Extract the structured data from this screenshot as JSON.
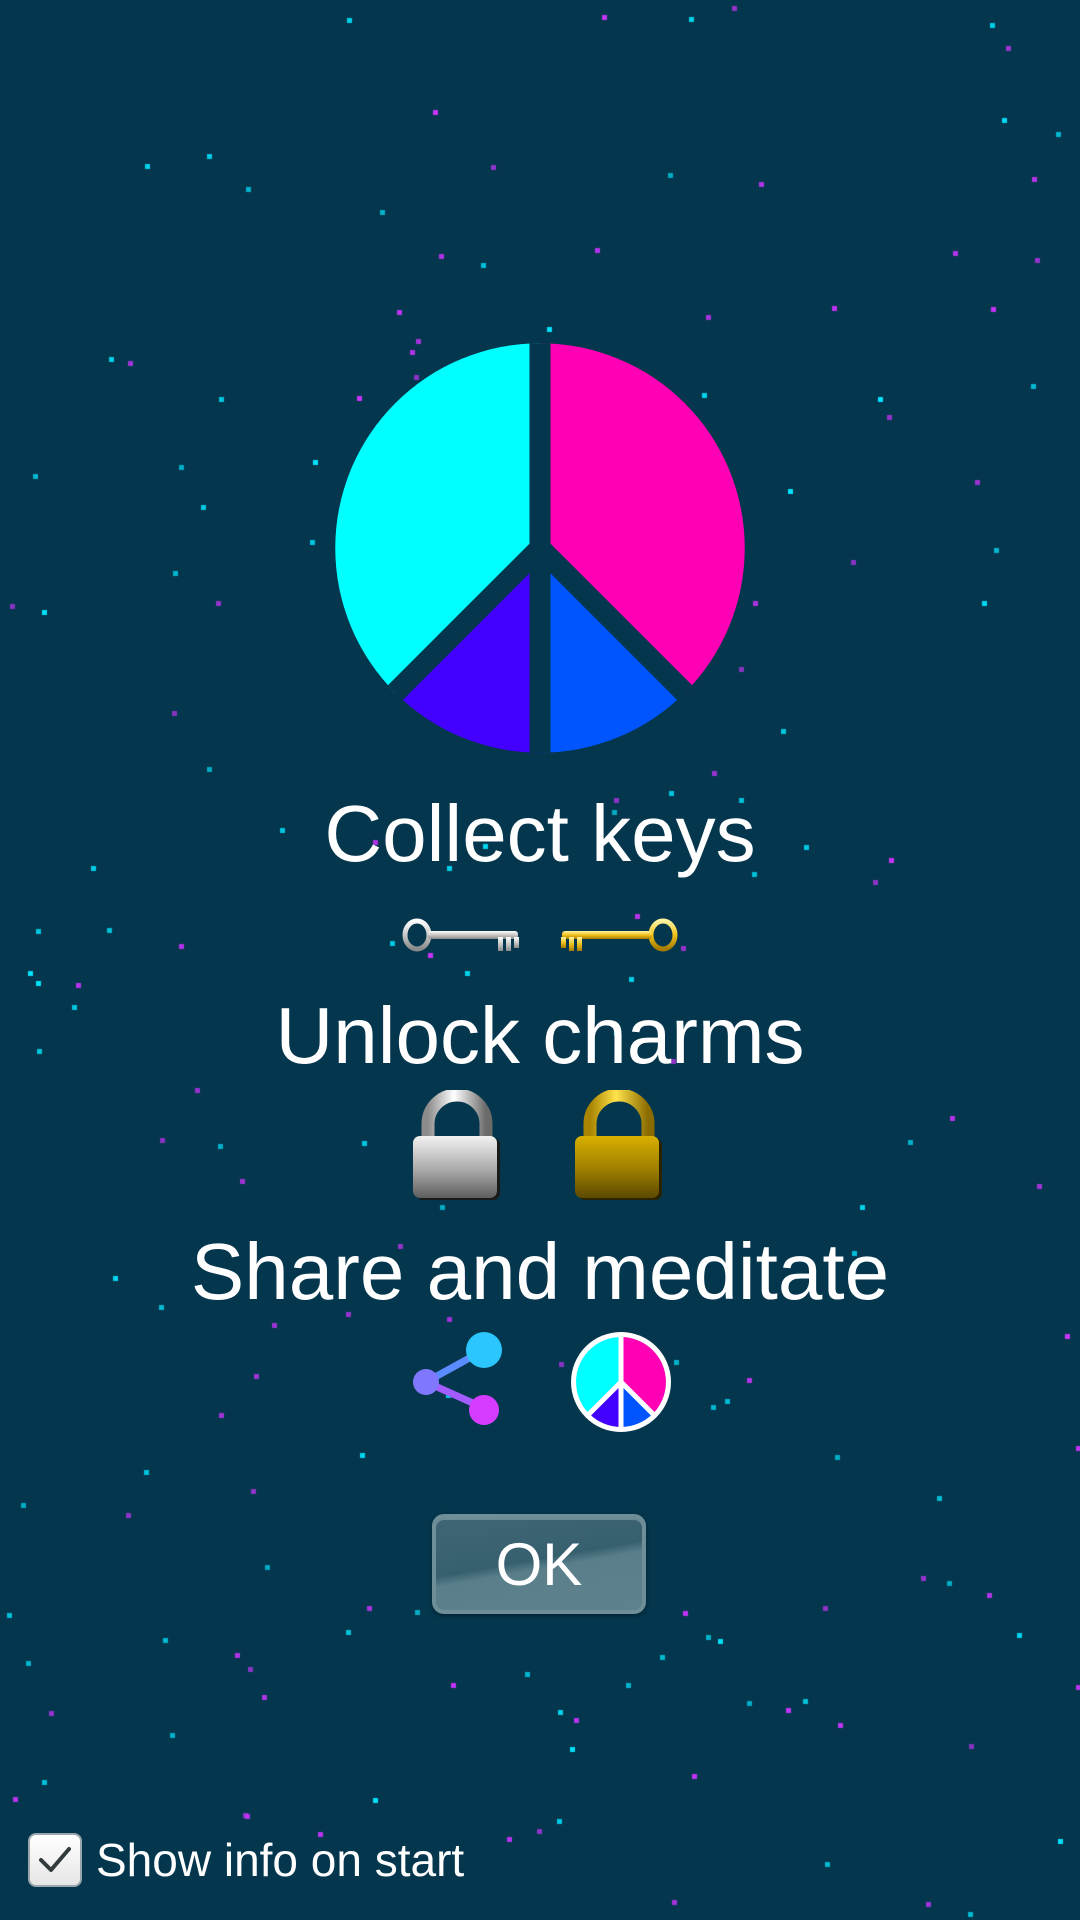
{
  "background": {
    "color": "#04364d",
    "star_colors": [
      "#00e5ff",
      "#cc33ff"
    ]
  },
  "logo": {
    "icon": "peace-sign-icon",
    "colors": {
      "top_left": "#00ffff",
      "top_right": "#ff00b4",
      "bottom_left": "#4400ff",
      "bottom_right": "#0055ff"
    }
  },
  "steps": [
    {
      "title": "Collect keys",
      "icons": [
        "silver-key-icon",
        "gold-key-icon"
      ]
    },
    {
      "title": "Unlock charms",
      "icons": [
        "silver-padlock-icon",
        "gold-padlock-icon"
      ]
    },
    {
      "title": "Share and meditate",
      "icons": [
        "share-icon",
        "peace-sign-icon"
      ]
    }
  ],
  "ok_button": {
    "label": "OK"
  },
  "show_info_on_start": {
    "label": "Show info on start",
    "checked": true
  }
}
